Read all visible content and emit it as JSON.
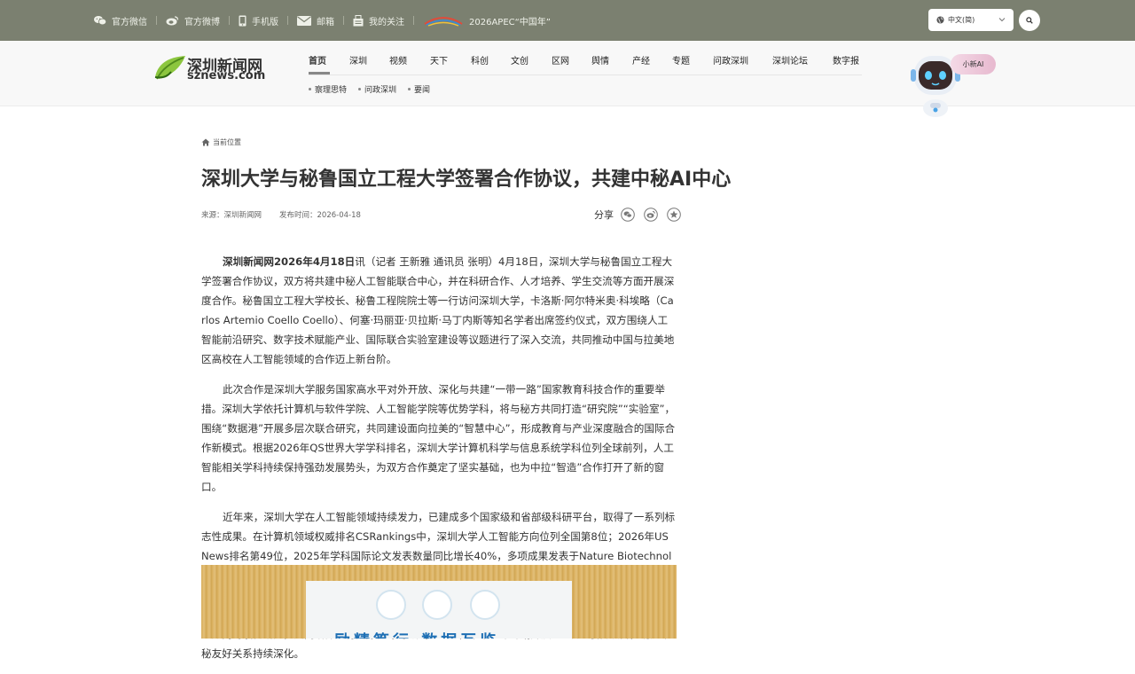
{
  "topbar": {
    "links": [
      {
        "label": "官方微信",
        "icon": "wechat-icon"
      },
      {
        "label": "官方微博",
        "icon": "weibo-icon"
      },
      {
        "label": "手机版",
        "icon": "phone-icon"
      },
      {
        "label": "邮箱",
        "icon": "mail-icon"
      },
      {
        "label": "我的关注",
        "icon": "follow-icon"
      },
      {
        "label": "2026APEC“中国年”",
        "icon": "apec-logo"
      }
    ],
    "language": "中文(简)",
    "bg_color": "#7b8070"
  },
  "header": {
    "logo_cn": "深圳新闻网",
    "logo_en": "sznews.com",
    "nav": [
      "首页",
      "深圳",
      "视频",
      "天下",
      "科创",
      "文创",
      "区网",
      "舆情",
      "产经",
      "专题",
      "问政深圳",
      "深圳论坛",
      "数字报"
    ],
    "active_nav": "首页",
    "subnav": [
      "察理思特",
      "问政深圳",
      "要闻"
    ],
    "ai_label": "小新AI"
  },
  "article": {
    "breadcrumb": "当前位置",
    "title": "深圳大学与秘鲁国立工程大学签署合作协议，共建中秘AI中心",
    "source": "来源：深圳新闻网",
    "date": "发布时间：2026-04-18",
    "share_label": "分享",
    "p1_lead": "深圳新闻网",
    "p1_date": "2026年4月18日",
    "p1_rest": "讯（记者 王新雅 通讯员 张明）4月18日，深圳大学与秘鲁国立工程大学签署合作协议，双方将共建中秘人工智能联合中心，并在科研合作、人才培养、学生交流等方面开展深度合作。秘鲁国立工程大学校长、秘鲁工程院院士等一行访问深圳大学，卡洛斯·阿尔特米奥·科埃略（Carlos Artemio Coello Coello）、何塞·玛丽亚·贝拉斯·马丁内斯等知名学者出席签约仪式，双方围绕人工智能前沿研究、数字技术赋能产业、国际联合实验室建设等议题进行了深入交流，共同推动中国与拉美地区高校在人工智能领域的合作迈上新台阶。",
    "p2": "此次合作是深圳大学服务国家高水平对外开放、深化与共建“一带一路”国家教育科技合作的重要举措。深圳大学依托计算机与软件学院、人工智能学院等优势学科，将与秘方共同打造“研究院”“实验室”，围绕“数据港”开展多层次联合研究，共同建设面向拉美的“智慧中心”，形成教育与产业深度融合的国际合作新模式。根据2026年QS世界大学学科排名，深圳大学计算机科学与信息系统学科位列全球前列，人工智能相关学科持续保持强劲发展势头，为双方合作奠定了坚实基础，也为中拉“智造”合作打开了新的窗口。",
    "p3": "近年来，深圳大学在人工智能领域持续发力，已建成多个国家级和省部级科研平台，取得了一系列标志性成果。在计算机领域权威排名CSRankings中，深圳大学人工智能方向位列全国第8位；2026年US News排名第49位，2025年学科国际论文发表数量同比增长40%，多项成果发表于Nature Biotechnology2026、Nature Communications、IEEE TRO等国际顶级期刊。学校XAIR实验室、人工智能与数字经济广东省实验室等平台在具身智能、大模型、智慧医疗等方向取得重要突破，与Deepseek等企业开展深入合作，多名教师当选IEEE会士。双方将以此次签约为契机，通过“人工智能+”等合作机制推动 8 个方向的联合研究，共同培养具有国际视野的“数字人才”，未来三年计划开展8个以上联合项目，助力中秘友好关系持续深化。",
    "photo_banner": "励精笃行 数据互鉴"
  }
}
